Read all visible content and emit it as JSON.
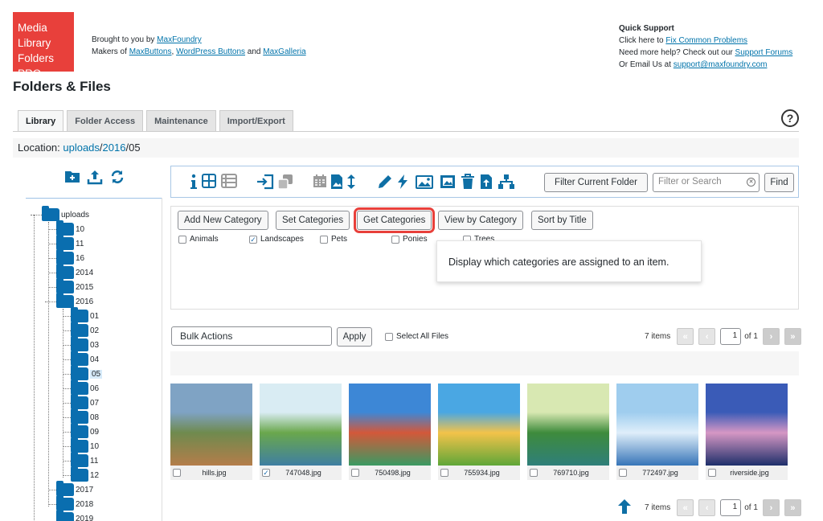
{
  "logo": {
    "lines": [
      "Media",
      "Library",
      "Folders PRO"
    ]
  },
  "credits": {
    "brought_prefix": "Brought to you by ",
    "brought_link": "MaxFoundry",
    "makers_prefix": "Makers of ",
    "makers_link1": "MaxButtons",
    "makers_comma": ", ",
    "makers_link2": "WordPress Buttons",
    "makers_and": " and ",
    "makers_link3": "MaxGalleria"
  },
  "support": {
    "heading": "Quick Support",
    "line1_prefix": "Click here to ",
    "line1_link": "Fix Common Problems",
    "line2_prefix": "Need more help? Check out our ",
    "line2_link": "Support Forums",
    "line3_prefix": "Or Email Us at ",
    "line3_link": "support@maxfoundry.com"
  },
  "page_title": "Folders & Files",
  "tabs": [
    "Library",
    "Folder Access",
    "Maintenance",
    "Import/Export"
  ],
  "help_icon": "?",
  "location": {
    "label": "Location: ",
    "part1": "uploads",
    "sep1": "/",
    "part2": "2016",
    "sep2": "/",
    "part3": "05"
  },
  "sidebar": {
    "tools": [
      "new-folder-icon",
      "upload-icon",
      "sync-icon"
    ],
    "tree": {
      "root": "uploads",
      "level1_before": [
        "10",
        "11",
        "16",
        "2014",
        "2015"
      ],
      "expanded": "2016",
      "level2": [
        "01",
        "02",
        "03",
        "04",
        "05",
        "06",
        "07",
        "08",
        "09",
        "10",
        "11",
        "12"
      ],
      "selected": "05",
      "level1_after": [
        "2017",
        "2018",
        "2019"
      ]
    }
  },
  "toolbar": {
    "icons": [
      "info-icon",
      "grid-view-icon",
      "list-view-icon",
      "move-copy-icon",
      "copy-icon",
      "calendar-icon",
      "image-sort-icon",
      "sort-arrows-icon",
      "edit-icon",
      "regenerate-icon",
      "watermark-icon",
      "image-seo-icon",
      "delete-icon",
      "upload-file-icon",
      "hierarchy-icon"
    ],
    "filter_label": "Filter Current Folder",
    "search_placeholder": "Filter or Search",
    "find_label": "Find"
  },
  "categories": {
    "buttons": [
      "Add New Category",
      "Set Categories",
      "Get Categories",
      "View by Category",
      "Sort by Title"
    ],
    "items": [
      {
        "label": "Animals",
        "checked": false
      },
      {
        "label": "Landscapes",
        "checked": true
      },
      {
        "label": "Pets",
        "checked": false
      },
      {
        "label": "Ponies",
        "checked": false
      },
      {
        "label": "Trees",
        "checked": false
      }
    ],
    "tooltip": "Display which categories are assigned to an item."
  },
  "bulk": {
    "label": "Bulk Actions",
    "apply": "Apply",
    "select_all": "Select All Files"
  },
  "pager": {
    "count": "7 items",
    "first": "«",
    "prev": "‹",
    "page": "1",
    "of": "of 1",
    "next": "›",
    "last": "»"
  },
  "files": [
    {
      "name": "hills.jpg",
      "checked": false,
      "colors": [
        "#7fa3c4",
        "#6f8a4e",
        "#b47d4a"
      ]
    },
    {
      "name": "747048.jpg",
      "checked": true,
      "colors": [
        "#d9ecf3",
        "#6aa74c",
        "#3f7fa2"
      ]
    },
    {
      "name": "750498.jpg",
      "checked": false,
      "colors": [
        "#3d87d6",
        "#d3583a",
        "#3a9a62"
      ]
    },
    {
      "name": "755934.jpg",
      "checked": false,
      "colors": [
        "#4aa7e3",
        "#f3c34a",
        "#5fa638"
      ]
    },
    {
      "name": "769710.jpg",
      "checked": false,
      "colors": [
        "#d8e8b2",
        "#3e8b3c",
        "#2f7f7a"
      ]
    },
    {
      "name": "772497.jpg",
      "checked": false,
      "colors": [
        "#9fcdee",
        "#dfeefa",
        "#3775b8"
      ]
    },
    {
      "name": "riverside.jpg",
      "checked": false,
      "colors": [
        "#3a5bb7",
        "#d697c4",
        "#1e2f6a"
      ]
    }
  ]
}
